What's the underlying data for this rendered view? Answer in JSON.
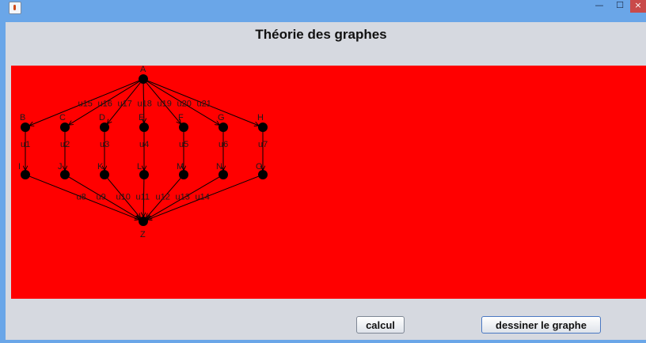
{
  "window": {
    "title": "",
    "controls": {
      "minimize": "—",
      "maximize": "☐",
      "close": "×"
    }
  },
  "page": {
    "title": "Théorie des graphes"
  },
  "graph": {
    "background_color": "#ff0000",
    "node_color": "#000000",
    "nodes": [
      "A",
      "B",
      "C",
      "D",
      "E",
      "F",
      "G",
      "H",
      "I",
      "J",
      "K",
      "L",
      "M",
      "N",
      "O",
      "Z"
    ],
    "edges": [
      {
        "from": "A",
        "to": "B",
        "label": "u15"
      },
      {
        "from": "A",
        "to": "C",
        "label": "u16"
      },
      {
        "from": "A",
        "to": "D",
        "label": "u17"
      },
      {
        "from": "A",
        "to": "E",
        "label": "u18"
      },
      {
        "from": "A",
        "to": "F",
        "label": "u19"
      },
      {
        "from": "A",
        "to": "G",
        "label": "u20"
      },
      {
        "from": "A",
        "to": "H",
        "label": "u21"
      },
      {
        "from": "B",
        "to": "I",
        "label": "u1"
      },
      {
        "from": "C",
        "to": "J",
        "label": "u2"
      },
      {
        "from": "D",
        "to": "K",
        "label": "u3"
      },
      {
        "from": "E",
        "to": "L",
        "label": "u4"
      },
      {
        "from": "F",
        "to": "M",
        "label": "u5"
      },
      {
        "from": "G",
        "to": "N",
        "label": "u6"
      },
      {
        "from": "H",
        "to": "O",
        "label": "u7"
      },
      {
        "from": "I",
        "to": "Z",
        "label": "u8"
      },
      {
        "from": "J",
        "to": "Z",
        "label": "u9"
      },
      {
        "from": "K",
        "to": "Z",
        "label": "u10"
      },
      {
        "from": "L",
        "to": "Z",
        "label": "u11"
      },
      {
        "from": "M",
        "to": "Z",
        "label": "u12"
      },
      {
        "from": "N",
        "to": "Z",
        "label": "u13"
      },
      {
        "from": "O",
        "to": "Z",
        "label": "u14"
      }
    ]
  },
  "buttons": {
    "calcul": "calcul",
    "dessiner": "dessiner le graphe"
  }
}
